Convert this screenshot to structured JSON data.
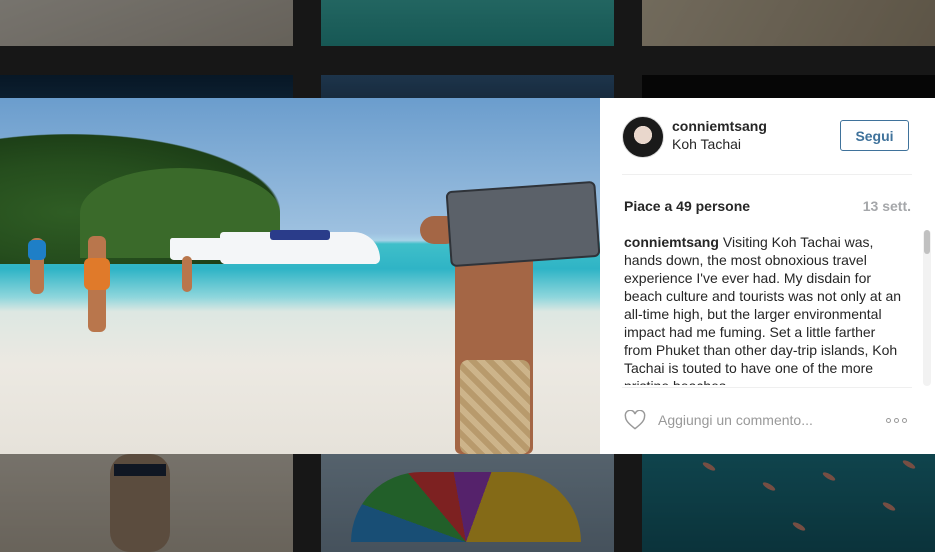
{
  "post": {
    "username": "conniemtsang",
    "location": "Koh Tachai",
    "follow_label": "Segui",
    "likes_text": "Piace a 49 persone",
    "date": "13 sett.",
    "caption_user": "conniemtsang",
    "caption_text": "Visiting Koh Tachai was, hands down, the most obnoxious travel experience I've ever had. My disdain for beach culture and tourists was not only at an all-time high, but the larger environmental impact had me fuming. Set a little farther from Phuket than other day-trip islands, Koh Tachai is touted to have one of the more pristine beaches",
    "comment_placeholder": "Aggiungi un commento..."
  },
  "icons": {
    "like": "heart-icon",
    "more": "more-options-icon"
  },
  "colors": {
    "follow_blue": "#3f729b",
    "text": "#262626",
    "muted": "#a5a7aa"
  }
}
